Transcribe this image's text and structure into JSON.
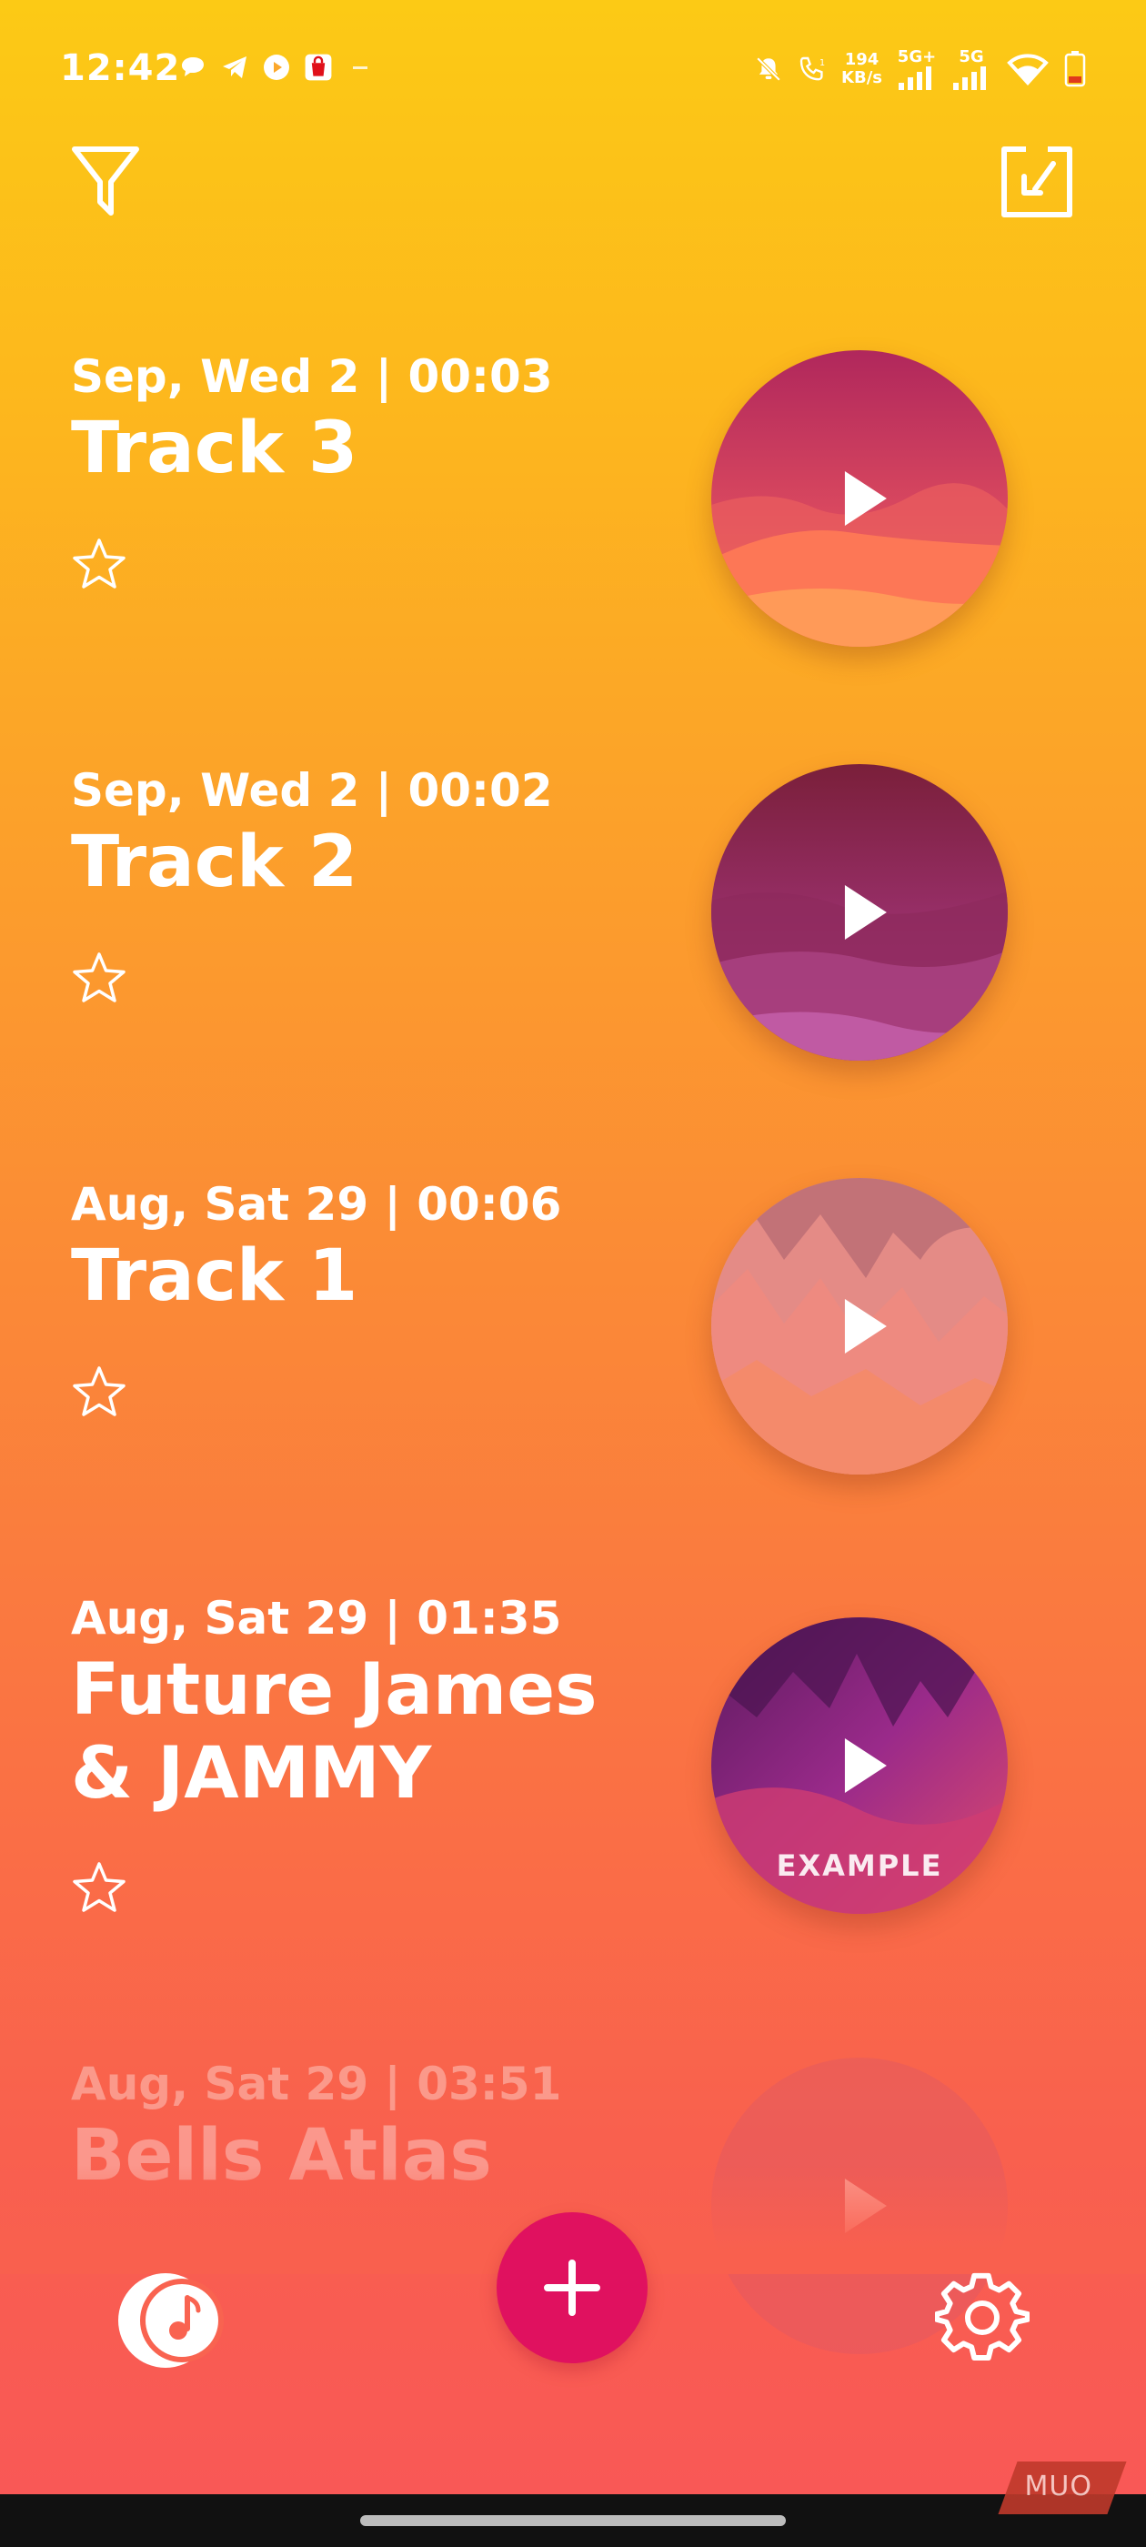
{
  "status_bar": {
    "time": "12:42",
    "net_speed_value": "194",
    "net_speed_unit": "KB/s",
    "signal_1": "5G+",
    "signal_2": "5G"
  },
  "toolbar": {
    "filter_icon": "filter-icon",
    "import_icon": "import-icon"
  },
  "tracks": [
    {
      "date": "Sep, Wed 2 | 00:03",
      "title": "Track 3",
      "starred": false,
      "badge": ""
    },
    {
      "date": "Sep, Wed 2 | 00:02",
      "title": "Track 2",
      "starred": false,
      "badge": ""
    },
    {
      "date": "Aug, Sat 29 | 00:06",
      "title": "Track 1",
      "starred": false,
      "badge": ""
    },
    {
      "date": "Aug, Sat 29 | 01:35",
      "title": "Future James & JAMMY",
      "starred": false,
      "badge": "EXAMPLE"
    },
    {
      "date": "Aug, Sat 29 | 03:51",
      "title": "Bells Atlas",
      "starred": false,
      "badge": ""
    }
  ],
  "bottom_bar": {
    "library_icon": "music-library-icon",
    "add_icon": "plus-icon",
    "settings_icon": "gear-icon"
  },
  "watermark": "MUO",
  "colors": {
    "gradient_top": "#fcca15",
    "gradient_bottom": "#f95757",
    "fab": "#e0115f"
  }
}
